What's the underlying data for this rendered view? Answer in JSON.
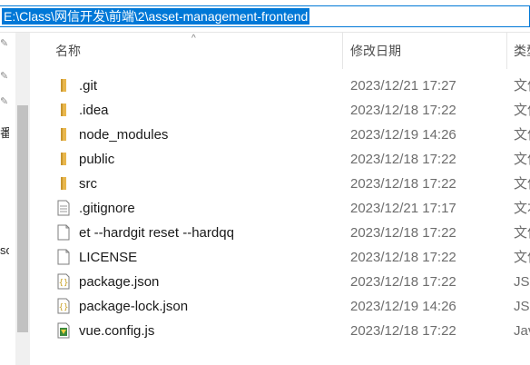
{
  "address_bar": {
    "path": "E:\\Class\\网信开发\\前端\\2\\asset-management-frontend"
  },
  "nav": {
    "fragments": [
      "番",
      "sc"
    ]
  },
  "columns": {
    "name": "名称",
    "modified": "修改日期",
    "type": "类型"
  },
  "files": [
    {
      "name": ".git",
      "modified": "2023/12/21 17:27",
      "type": "文件夹",
      "icon": "folder-icon"
    },
    {
      "name": ".idea",
      "modified": "2023/12/18 17:22",
      "type": "文件夹",
      "icon": "folder-icon"
    },
    {
      "name": "node_modules",
      "modified": "2023/12/19 14:26",
      "type": "文件夹",
      "icon": "folder-icon"
    },
    {
      "name": "public",
      "modified": "2023/12/18 17:22",
      "type": "文件夹",
      "icon": "folder-icon"
    },
    {
      "name": "src",
      "modified": "2023/12/18 17:22",
      "type": "文件夹",
      "icon": "folder-icon"
    },
    {
      "name": ".gitignore",
      "modified": "2023/12/21 17:17",
      "type": "文本文档",
      "icon": "text-file-icon"
    },
    {
      "name": "et --hardgit reset --hardqq",
      "modified": "2023/12/18 17:22",
      "type": "文件",
      "icon": "blank-file-icon"
    },
    {
      "name": "LICENSE",
      "modified": "2023/12/18 17:22",
      "type": "文件",
      "icon": "blank-file-icon"
    },
    {
      "name": "package.json",
      "modified": "2023/12/18 17:22",
      "type": "JSON",
      "icon": "json-file-icon"
    },
    {
      "name": "package-lock.json",
      "modified": "2023/12/19 14:26",
      "type": "JSON",
      "icon": "json-file-icon"
    },
    {
      "name": "vue.config.js",
      "modified": "2023/12/18 17:22",
      "type": "JavaScript",
      "icon": "js-file-icon"
    }
  ],
  "colors": {
    "selection": "#0078d7",
    "folder": "#e8b64c",
    "json_brace": "#c9a227"
  }
}
